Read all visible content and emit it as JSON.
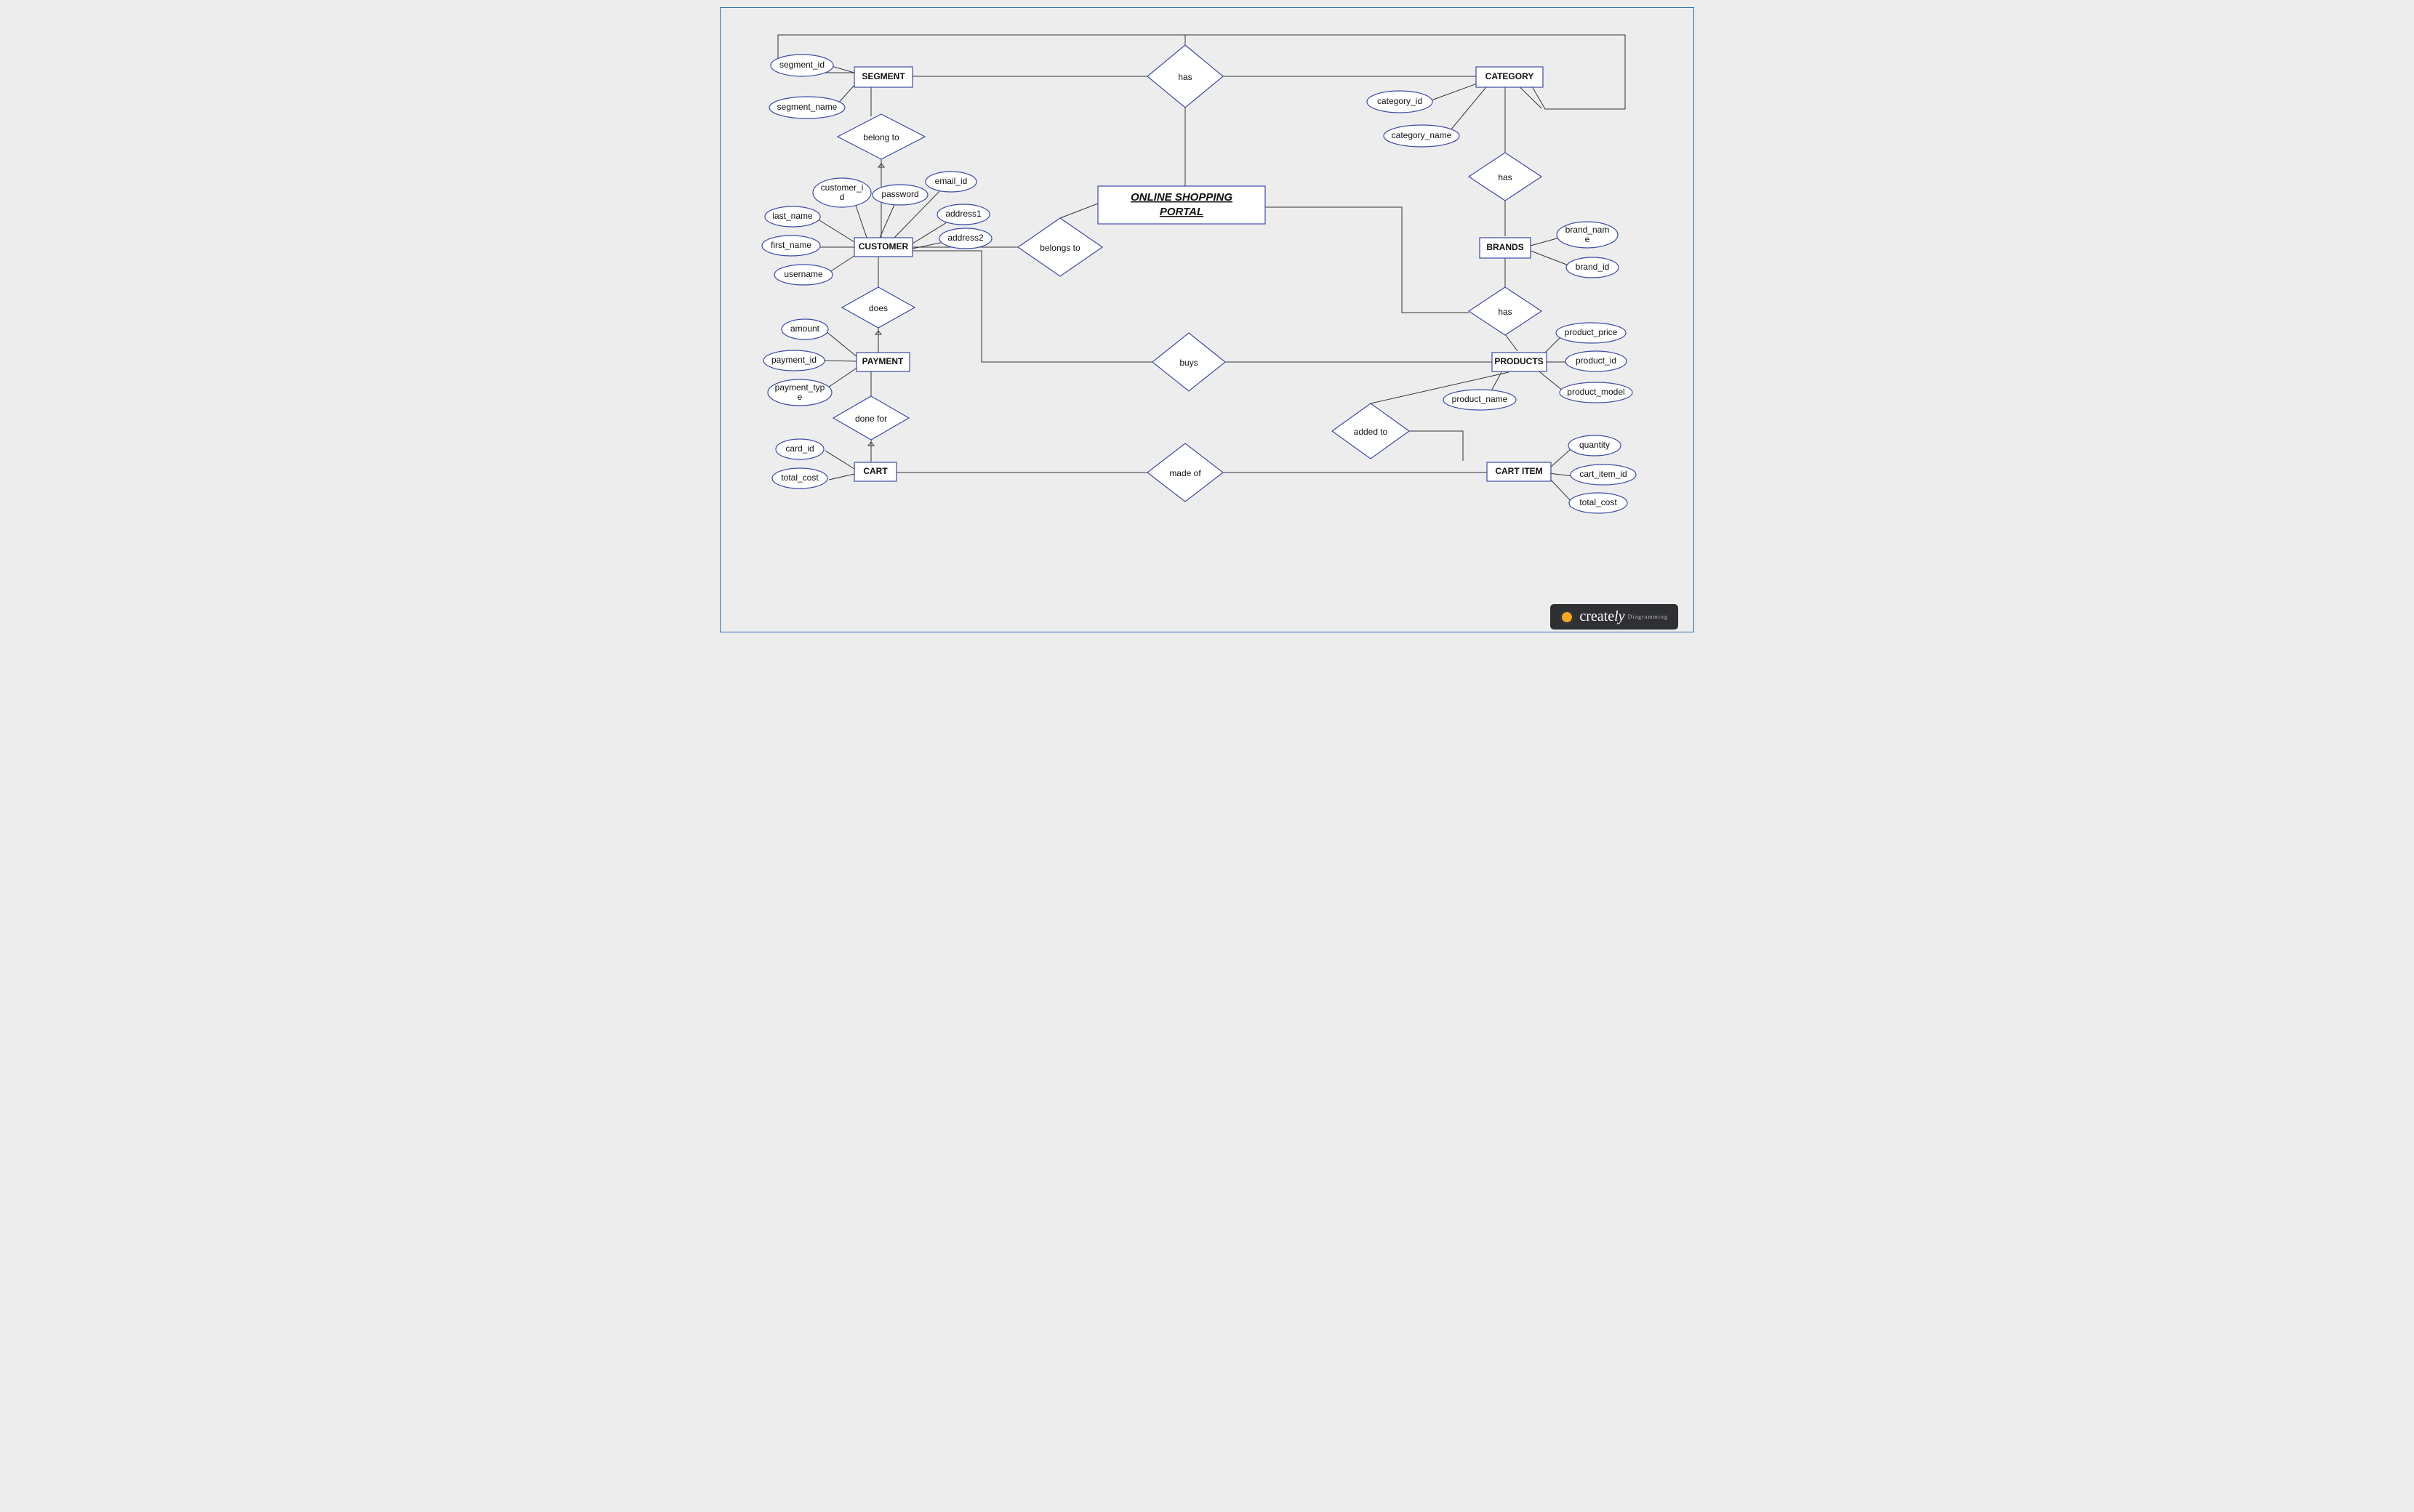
{
  "title_line1": "ONLINE SHOPPING",
  "title_line2": "PORTAL",
  "entities": {
    "segment": "SEGMENT",
    "category": "CATEGORY",
    "customer": "CUSTOMER",
    "payment": "PAYMENT",
    "cart": "CART",
    "brands": "BRANDS",
    "products": "PRODUCTS",
    "cart_item": "CART ITEM"
  },
  "relationships": {
    "has_top": "has",
    "belong_to": "belong to",
    "has_cat_brand": "has",
    "belongs_to": "belongs to",
    "does": "does",
    "buys": "buys",
    "has_brand_prod": "has",
    "done_for": "done for",
    "made_of": "made of",
    "added_to": "added to"
  },
  "attrs": {
    "segment_id": "segment_id",
    "segment_name": "segment_name",
    "category_id": "category_id",
    "category_name": "category_name",
    "customer_id_l1": "customer_i",
    "customer_id_l2": "d",
    "password": "password",
    "email_id": "email_id",
    "last_name": "last_name",
    "address1": "address1",
    "first_name": "first_name",
    "address2": "address2",
    "username": "username",
    "amount": "amount",
    "payment_id": "payment_id",
    "payment_type_l1": "payment_typ",
    "payment_type_l2": "e",
    "card_id": "card_id",
    "total_cost": "total_cost",
    "brand_name_l1": "brand_nam",
    "brand_name_l2": "e",
    "brand_id": "brand_id",
    "product_price": "product_price",
    "product_id": "product_id",
    "product_model": "product_model",
    "product_name": "product_name",
    "quantity": "quantity",
    "cart_item_id": "cart_item_id",
    "cart_item_total": "total_cost"
  },
  "logo": {
    "brand1": "create",
    "brand2": "ly",
    "sub": "Diagramming"
  }
}
